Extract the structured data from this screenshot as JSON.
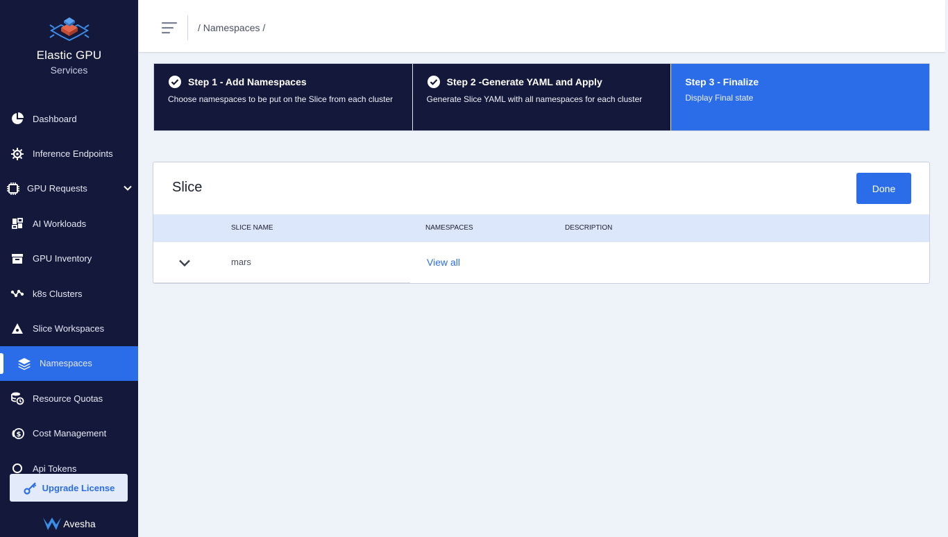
{
  "brand": {
    "title": "Elastic GPU",
    "subtitle": "Services",
    "footer": "Avesha"
  },
  "sidebar": {
    "items": [
      {
        "label": "Dashboard",
        "icon": "pie-chart-icon"
      },
      {
        "label": "Inference Endpoints",
        "icon": "gear-chip-icon"
      },
      {
        "label": "GPU Requests",
        "icon": "chip-icon"
      },
      {
        "label": "AI Workloads",
        "icon": "dashboard-blocks-icon"
      },
      {
        "label": "GPU Inventory",
        "icon": "archive-box-icon"
      },
      {
        "label": "k8s Clusters",
        "icon": "nodes-icon"
      },
      {
        "label": "Slice Workspaces",
        "icon": "pyramid-icon"
      },
      {
        "label": "Namespaces",
        "icon": "layers-icon"
      },
      {
        "label": "Resource Quotas",
        "icon": "coins-clock-icon"
      },
      {
        "label": "Cost Management",
        "icon": "dollar-coins-icon"
      },
      {
        "label": "Api Tokens",
        "icon": "token-icon"
      }
    ],
    "active": "Namespaces",
    "upgrade_label": "Upgrade License"
  },
  "header": {
    "breadcrumb": "/ Namespaces /"
  },
  "stepper": {
    "steps": [
      {
        "title": "Step 1 - Add Namespaces",
        "desc": "Choose namespaces to be put on the Slice from each cluster",
        "status": "completed"
      },
      {
        "title": "Step 2 -Generate YAML and Apply",
        "desc": "Generate Slice YAML with all namespaces for each cluster",
        "status": "completed"
      },
      {
        "title": "Step 3 - Finalize",
        "desc": "Display Final state",
        "status": "current"
      }
    ]
  },
  "slice_card": {
    "title": "Slice",
    "done_label": "Done",
    "columns": [
      "SLICE NAME",
      "NAMESPACES",
      "DESCRIPTION"
    ],
    "rows": [
      {
        "slice_name": "mars",
        "namespaces_link": "View all",
        "description": ""
      }
    ]
  },
  "colors": {
    "sidebar_bg": "#14183a",
    "accent": "#2b6de9",
    "table_header_bg": "#dde7fb",
    "page_bg": "#eef2f9"
  }
}
